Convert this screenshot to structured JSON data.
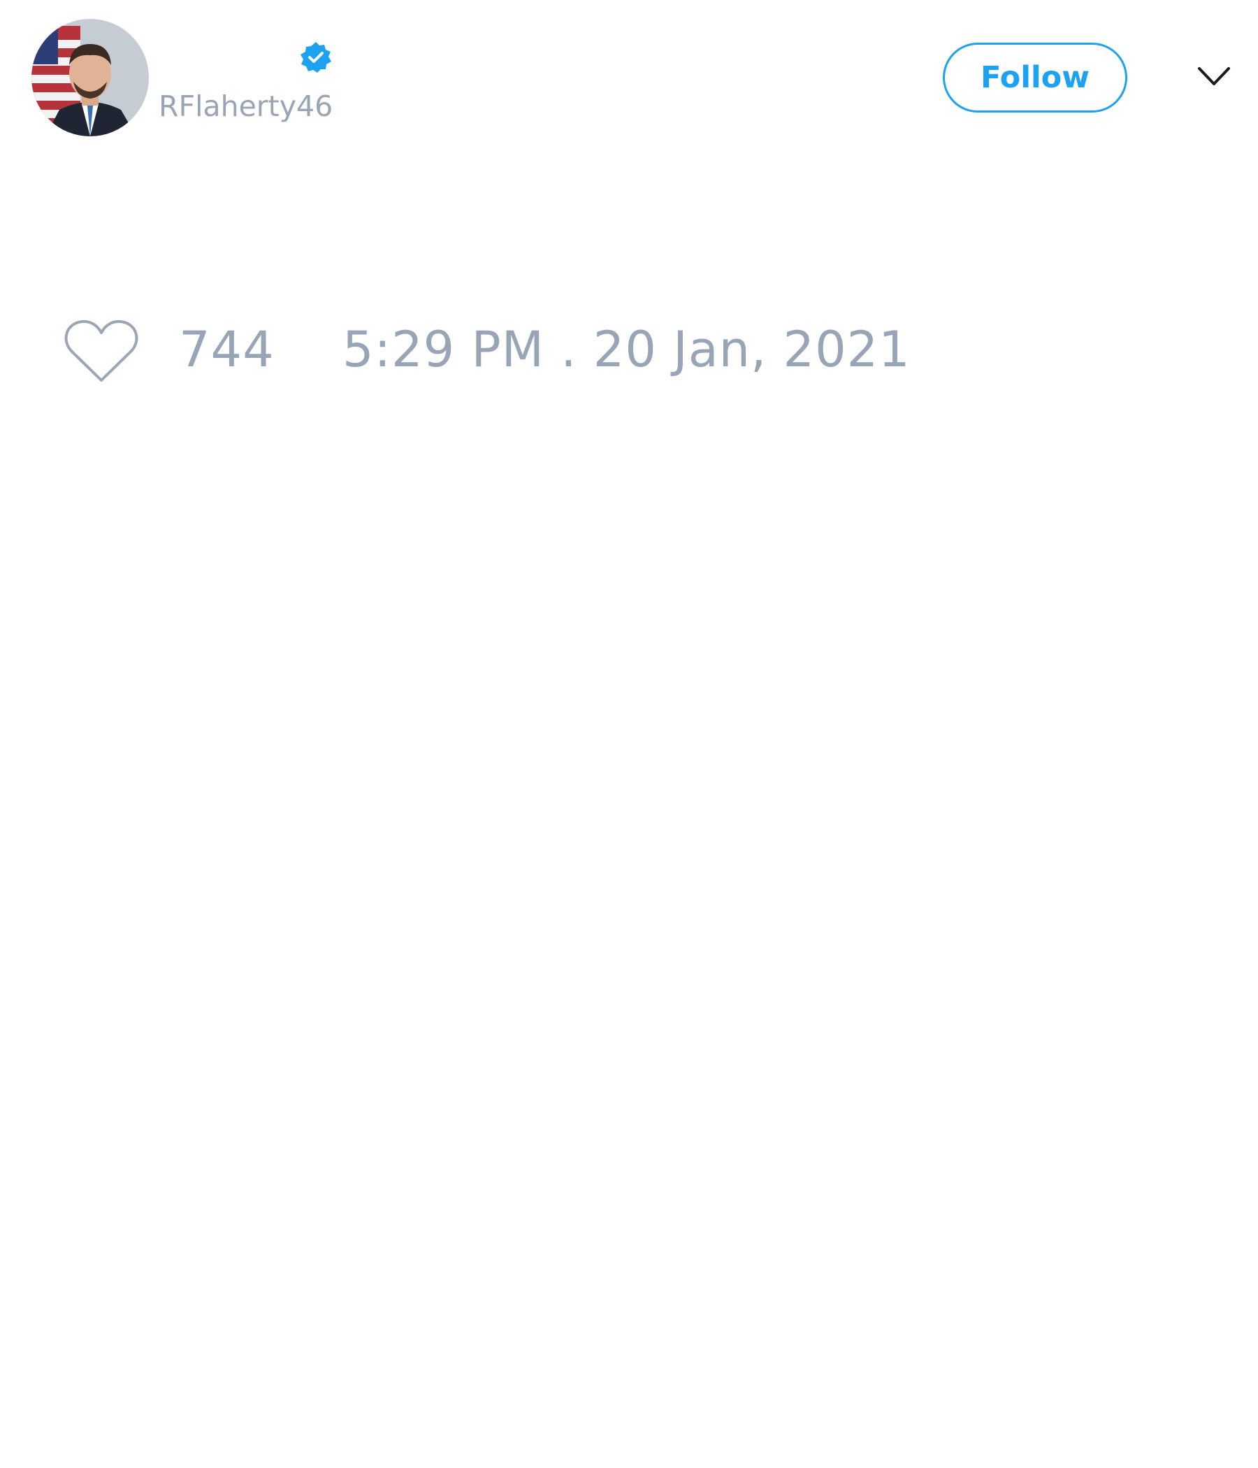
{
  "author": {
    "name": "",
    "handle": "RFlaherty46",
    "verified": true,
    "avatar": "profile-photo"
  },
  "header": {
    "follow_label": "Follow",
    "menu_icon": "chevron-down-icon"
  },
  "footer": {
    "like_icon": "heart-icon",
    "like_count": "744",
    "timestamp": "5:29 PM . 20 Jan, 2021"
  },
  "colors": {
    "accent": "#1da1f2",
    "muted_text": "#98a5b7",
    "background": "#ffffff",
    "icon_stroke": "#9aa6b5"
  }
}
